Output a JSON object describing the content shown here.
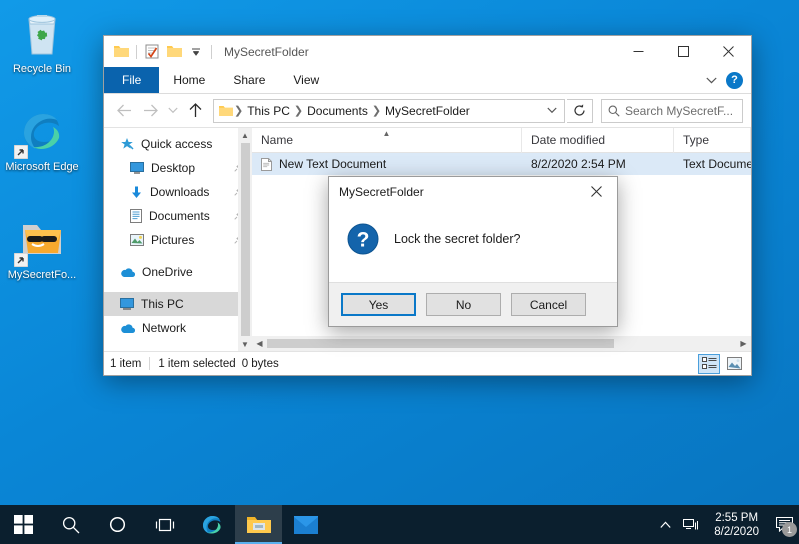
{
  "desktop": {
    "icons": [
      {
        "name": "recycle-bin",
        "label": "Recycle Bin"
      },
      {
        "name": "microsoft-edge",
        "label": "Microsoft Edge"
      },
      {
        "name": "mysecretfolder-shortcut",
        "label": "MySecretFo..."
      }
    ]
  },
  "explorer": {
    "title": "MySecretFolder",
    "quick_access_toolbar": {
      "folder_icon": "folder-icon",
      "properties_icon": "properties-icon",
      "new_folder_icon": "new-folder-icon",
      "customize_icon": "chevron-down-icon"
    },
    "window_controls": {
      "minimize": "minimize-icon",
      "maximize": "maximize-icon",
      "close": "close-icon"
    },
    "ribbon": {
      "tabs": [
        {
          "label": "File",
          "active": true
        },
        {
          "label": "Home",
          "active": false
        },
        {
          "label": "Share",
          "active": false
        },
        {
          "label": "View",
          "active": false
        }
      ],
      "collapse_icon": "chevron-down-icon",
      "help_label": "?"
    },
    "navigation": {
      "back_icon": "arrow-left-icon",
      "forward_icon": "arrow-right-icon",
      "recent_icon": "chevron-down-icon",
      "up_icon": "arrow-up-icon",
      "breadcrumbs": [
        "This PC",
        "Documents",
        "MySecretFolder"
      ],
      "address_dropdown_icon": "chevron-down-icon",
      "refresh_icon": "refresh-icon",
      "search": {
        "placeholder": "Search MySecretF...",
        "value": "",
        "icon": "search-icon"
      }
    },
    "nav_pane": {
      "items": [
        {
          "label": "Quick access",
          "icon": "star-pin-icon",
          "indent": false,
          "pinned": false,
          "selected": false
        },
        {
          "label": "Desktop",
          "icon": "desktop-icon",
          "indent": true,
          "pinned": true,
          "selected": false
        },
        {
          "label": "Downloads",
          "icon": "downloads-icon",
          "indent": true,
          "pinned": true,
          "selected": false
        },
        {
          "label": "Documents",
          "icon": "documents-icon",
          "indent": true,
          "pinned": true,
          "selected": false
        },
        {
          "label": "Pictures",
          "icon": "pictures-icon",
          "indent": true,
          "pinned": true,
          "selected": false
        },
        {
          "label": "OneDrive",
          "icon": "onedrive-icon",
          "indent": false,
          "pinned": false,
          "selected": false
        },
        {
          "label": "This PC",
          "icon": "this-pc-icon",
          "indent": false,
          "pinned": false,
          "selected": true
        },
        {
          "label": "Network",
          "icon": "network-icon",
          "indent": false,
          "pinned": false,
          "selected": false
        }
      ]
    },
    "file_list": {
      "columns": [
        {
          "label": "Name",
          "sorted": true,
          "sort_direction": "ascending"
        },
        {
          "label": "Date modified",
          "sorted": false
        },
        {
          "label": "Type",
          "sorted": false
        }
      ],
      "rows": [
        {
          "name": "New Text Document",
          "date_modified": "8/2/2020 2:54 PM",
          "type": "Text Docume",
          "icon": "text-file-icon",
          "selected": true
        }
      ]
    },
    "status_bar": {
      "item_count": "1 item",
      "selection": "1 item selected",
      "size": "0 bytes",
      "views": [
        {
          "name": "details-view",
          "selected": true
        },
        {
          "name": "large-icons-view",
          "selected": false
        }
      ]
    }
  },
  "dialog": {
    "title": "MySecretFolder",
    "close_icon": "close-icon",
    "icon": "question-icon",
    "message": "Lock the secret folder?",
    "buttons": [
      {
        "label": "Yes",
        "focused": true
      },
      {
        "label": "No",
        "focused": false
      },
      {
        "label": "Cancel",
        "focused": false
      }
    ]
  },
  "taskbar": {
    "items": [
      {
        "name": "start-button",
        "active": false
      },
      {
        "name": "search-icon",
        "active": false
      },
      {
        "name": "cortana-icon",
        "active": false
      },
      {
        "name": "task-view-icon",
        "active": false
      },
      {
        "name": "edge-taskbar-icon",
        "active": false
      },
      {
        "name": "file-explorer-taskbar-icon",
        "active": true
      },
      {
        "name": "mail-taskbar-icon",
        "active": false
      }
    ],
    "tray": {
      "show_hidden_icon": "chevron-up-icon",
      "network_icon": "network-icon",
      "time": "2:55 PM",
      "date": "8/2/2020",
      "notification_icon": "notification-icon",
      "notification_count": "1"
    }
  },
  "colors": {
    "accent": "#0a78c8",
    "desktop_background": "#0a86d6",
    "taskbar": "#0b1f2e",
    "ribbon_file_tab": "#0a63ad",
    "selection": "#dbe9f7"
  }
}
